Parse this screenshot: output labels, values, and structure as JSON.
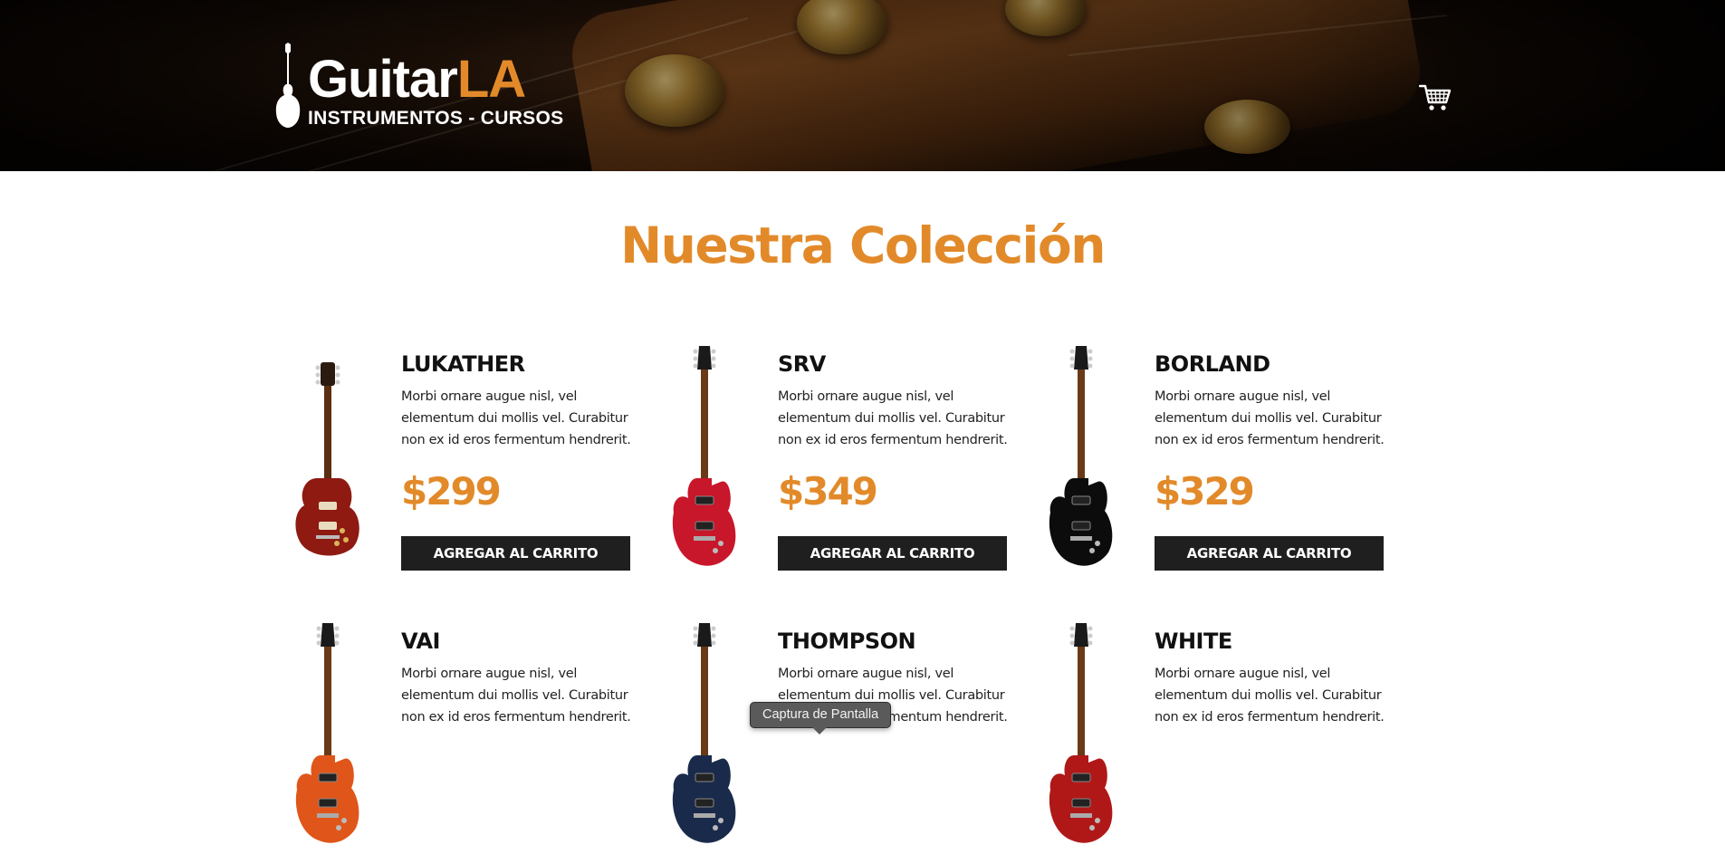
{
  "header": {
    "logo": {
      "word_main": "Guitar",
      "word_accent": "LA",
      "subtitle": "INSTRUMENTOS - CURSOS"
    },
    "cart_icon": "cart-icon"
  },
  "main": {
    "title": "Nuestra Colección",
    "products": [
      {
        "name": "LUKATHER",
        "description": "Morbi ornare augue nisl, vel elementum dui mollis vel. Curabitur non ex id eros fermentum hendrerit.",
        "price": "$299",
        "button_label": "AGREGAR AL CARRITO",
        "guitar_style": "les-paul",
        "body_color": "#8e1a12"
      },
      {
        "name": "SRV",
        "description": "Morbi ornare augue nisl, vel elementum dui mollis vel. Curabitur non ex id eros fermentum hendrerit.",
        "price": "$349",
        "button_label": "AGREGAR AL CARRITO",
        "guitar_style": "superstrat",
        "body_color": "#c8162a"
      },
      {
        "name": "BORLAND",
        "description": "Morbi ornare augue nisl, vel elementum dui mollis vel. Curabitur non ex id eros fermentum hendrerit.",
        "price": "$329",
        "button_label": "AGREGAR AL CARRITO",
        "guitar_style": "superstrat",
        "body_color": "#0c0c0c"
      },
      {
        "name": "VAI",
        "description": "Morbi ornare augue nisl, vel elementum dui mollis vel. Curabitur non ex id eros fermentum hendrerit.",
        "price": "",
        "button_label": "",
        "guitar_style": "superstrat",
        "body_color": "#e0551a"
      },
      {
        "name": "THOMPSON",
        "description": "Morbi ornare augue nisl, vel elementum dui mollis vel. Curabitur non ex id eros fermentum hendrerit.",
        "price": "",
        "button_label": "",
        "guitar_style": "superstrat",
        "body_color": "#1a2a4a"
      },
      {
        "name": "WHITE",
        "description": "Morbi ornare augue nisl, vel elementum dui mollis vel. Curabitur non ex id eros fermentum hendrerit.",
        "price": "",
        "button_label": "",
        "guitar_style": "superstrat",
        "body_color": "#b01818"
      }
    ]
  },
  "tooltip": {
    "text": "Captura de Pantalla"
  },
  "colors": {
    "accent": "#e28a2a",
    "button_bg": "#1f1f1f",
    "text": "#111111"
  }
}
